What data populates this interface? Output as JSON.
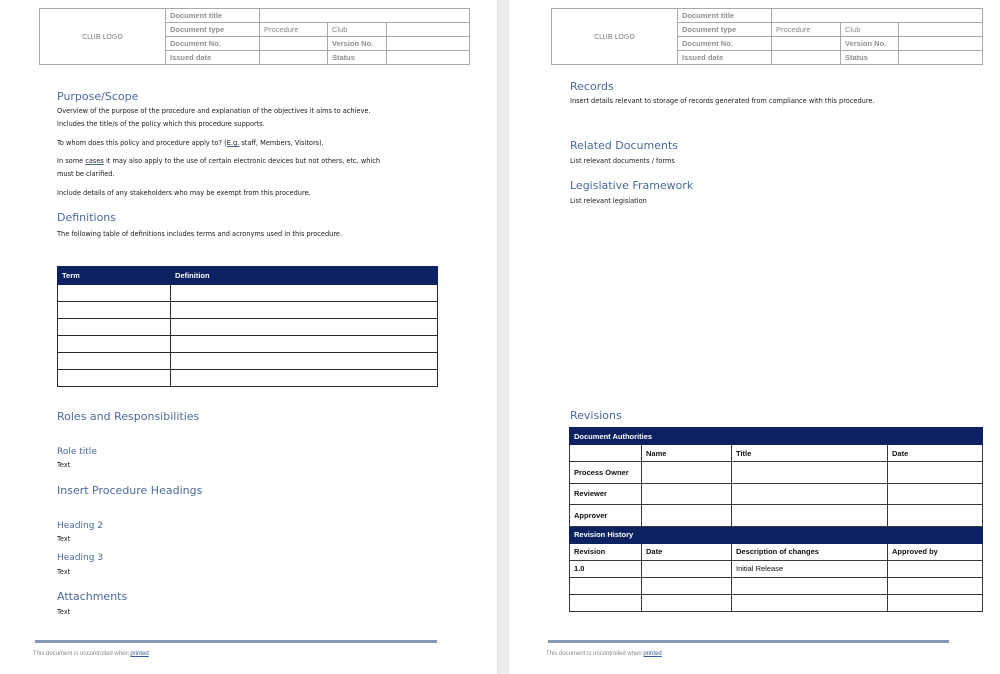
{
  "header": {
    "logo": "CLUB LOGO",
    "doc_title_label": "Document title",
    "doc_title_value": "",
    "doc_type_label": "Document type",
    "doc_type_value": "Procedure",
    "club_label": "Club",
    "club_value": "",
    "doc_no_label": "Document No.",
    "doc_no_value": "",
    "version_label": "Version No.",
    "version_value": "",
    "issued_label": "Issued date",
    "issued_value": "",
    "status_label": "Status",
    "status_value": ""
  },
  "left": {
    "purpose": {
      "heading": "Purpose/Scope",
      "line1": "Overview of the purpose of the procedure and explanation of the objectives it aims to achieve.",
      "line2": "Includes the title/s of the policy which this procedure supports.",
      "line3_a": "To whom does this policy and procedure apply to? (",
      "line3_u": "E.g.",
      "line3_b": " staff, Members, Visitors).",
      "line4_a": "In some ",
      "line4_u": "cases",
      "line4_b": " it may also apply to the use of certain electronic devices but not others, etc. which",
      "line5": "must be clarified.",
      "line6": "Include details of any stakeholders who may be exempt from this procedure."
    },
    "definitions": {
      "heading": "Definitions",
      "intro": "The following table of definitions includes terms and acronyms used in this procedure.",
      "columns": [
        "Term",
        "Definition"
      ],
      "rows": [
        [
          "",
          ""
        ],
        [
          "",
          ""
        ],
        [
          "",
          ""
        ],
        [
          "",
          ""
        ],
        [
          "",
          ""
        ],
        [
          "",
          ""
        ]
      ]
    },
    "roles": {
      "heading": "Roles and Responsibilities",
      "sub": "Role title",
      "text": "Text"
    },
    "procedure": {
      "heading": "Insert Procedure Headings",
      "h2": "Heading 2",
      "h2_text": "Text",
      "h3": "Heading 3",
      "h3_text": "Text"
    },
    "attachments": {
      "heading": "Attachments",
      "text": "Text"
    }
  },
  "right": {
    "records": {
      "heading": "Records",
      "text": "Insert details relevant to storage of records generated from compliance with this procedure."
    },
    "related": {
      "heading": "Related Documents",
      "text": "List relevant documents / forms"
    },
    "legislative": {
      "heading": "Legislative Framework",
      "text": "List relevant legislation"
    },
    "revisions": {
      "heading": "Revisions",
      "authorities_title": "Document Authorities",
      "authorities_columns": [
        "",
        "Name",
        "Title",
        "Date"
      ],
      "authorities_rows": [
        [
          "Process Owner",
          "",
          "",
          ""
        ],
        [
          "Reviewer",
          "",
          "",
          ""
        ],
        [
          "Approver",
          "",
          "",
          ""
        ]
      ],
      "history_title": "Revision History",
      "history_columns": [
        "Revision",
        "Date",
        "Description of changes",
        "Approved by"
      ],
      "history_rows": [
        [
          "1.0",
          "",
          "Initial Release",
          ""
        ],
        [
          "",
          "",
          "",
          ""
        ],
        [
          "",
          "",
          "",
          ""
        ]
      ]
    }
  },
  "footer": {
    "text": "This document is uncontrolled when ",
    "link": "printed"
  }
}
